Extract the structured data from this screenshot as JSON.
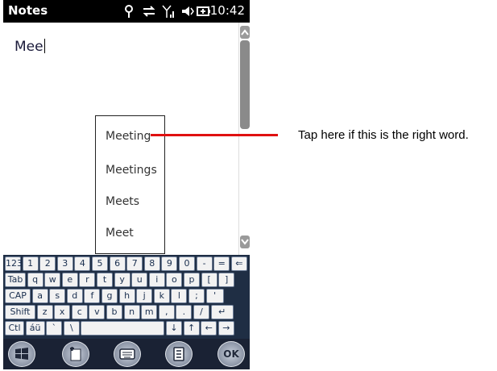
{
  "statusbar": {
    "title": "Notes",
    "time": "10:42",
    "icons": [
      "signal-antenna-icon",
      "data-sync-icon",
      "signal-bars-icon",
      "volume-icon",
      "battery-icon"
    ]
  },
  "editor": {
    "text": "Mee"
  },
  "suggestions": [
    "Meeting",
    "Meetings",
    "Meets",
    "Meet"
  ],
  "keyboard": {
    "rows": [
      [
        "123",
        "1",
        "2",
        "3",
        "4",
        "5",
        "6",
        "7",
        "8",
        "9",
        "0",
        "-",
        "=",
        "⇐"
      ],
      [
        "Tab",
        "q",
        "w",
        "e",
        "r",
        "t",
        "y",
        "u",
        "i",
        "o",
        "p",
        "[",
        "]"
      ],
      [
        "CAP",
        "a",
        "s",
        "d",
        "f",
        "g",
        "h",
        "j",
        "k",
        "l",
        ";",
        "'"
      ],
      [
        "Shift",
        "z",
        "x",
        "c",
        "v",
        "b",
        "n",
        "m",
        ",",
        ".",
        "/",
        "↵"
      ],
      [
        "Ctl",
        "áü",
        "`",
        "\\",
        " ",
        "↓",
        "↑",
        "←",
        "→"
      ]
    ]
  },
  "softbar": {
    "ok_label": "OK",
    "icons": [
      "windows-start-icon",
      "new-note-icon",
      "keyboard-icon",
      "menu-icon",
      "ok-icon"
    ]
  },
  "annotation": {
    "text": "Tap here if this is the right word.",
    "line_color": "#e01010"
  }
}
